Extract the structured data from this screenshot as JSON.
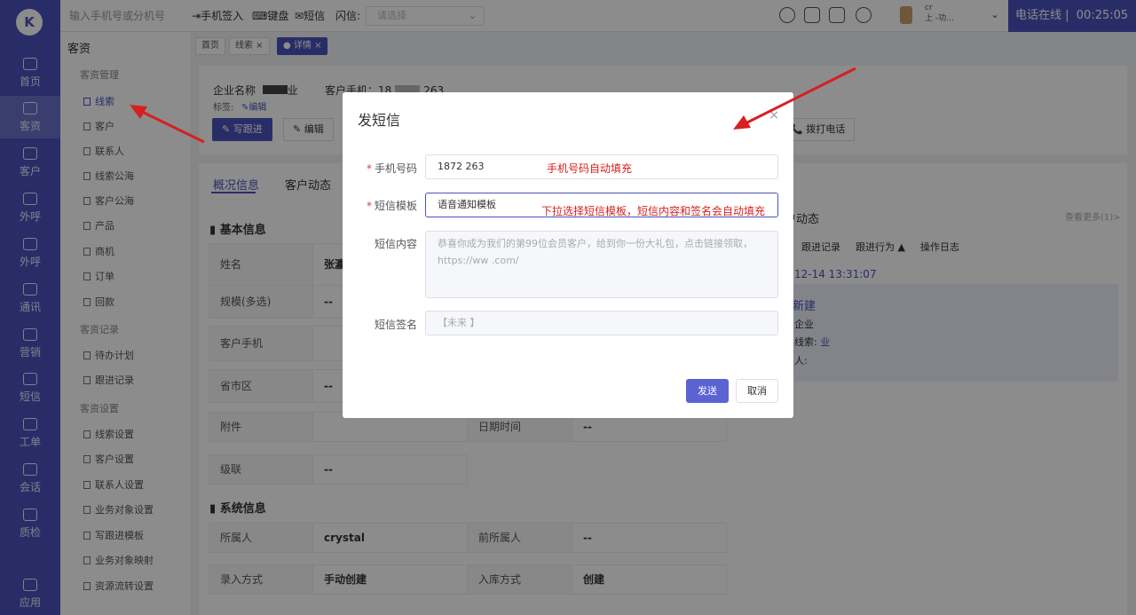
{
  "app": {
    "logo_letter": "K"
  },
  "leftnav": [
    {
      "label": "首页",
      "icon": "home-icon"
    },
    {
      "label": "客资",
      "icon": "users-icon"
    },
    {
      "label": "客户",
      "icon": "user-icon"
    },
    {
      "label": "外呼",
      "icon": "phone-out-icon"
    },
    {
      "label": "外呼",
      "icon": "phone-in-icon"
    },
    {
      "label": "通讯",
      "icon": "contacts-icon"
    },
    {
      "label": "营销",
      "icon": "gear-icon"
    },
    {
      "label": "短信",
      "icon": "mail-icon"
    },
    {
      "label": "工单",
      "icon": "clipboard-icon"
    },
    {
      "label": "会话",
      "icon": "chat-icon"
    },
    {
      "label": "质检",
      "icon": "check-icon"
    },
    {
      "label": "应用",
      "icon": "apps-icon"
    }
  ],
  "topbar": {
    "search_placeholder": "输入手机号或分机号",
    "phone_login": "手机签入",
    "keyboard": "键盘",
    "sms": "短信",
    "flash_label": "闪信:",
    "flash_placeholder": "请选择",
    "user_line1": "cr",
    "user_line2": "上  -功...",
    "status": "电话在线 |",
    "timer": "00:25:05"
  },
  "side": {
    "title": "客资",
    "groups": [
      {
        "label": "客资管理",
        "items": [
          "线索",
          "客户",
          "联系人",
          "线索公海",
          "客户公海",
          "产品",
          "商机",
          "订单",
          "回款"
        ]
      },
      {
        "label": "客资记录",
        "items": [
          "待办计划",
          "跟进记录"
        ]
      },
      {
        "label": "客资设置",
        "items": [
          "线索设置",
          "客户设置",
          "联系人设置",
          "业务对象设置",
          "写跟进模板",
          "业务对象映射",
          "资源流转设置"
        ]
      }
    ]
  },
  "tabs": [
    "首页",
    "线索 ×",
    "● 详情 ×"
  ],
  "header": {
    "company_label": "企业名称",
    "company_value": "业",
    "mobile_label": "客户手机：18",
    "mobile_suffix": "263",
    "tag_label": "标签:",
    "tag_edit": "编辑",
    "btn_follow": "写跟进",
    "btn_edit": "编辑",
    "btn_call": "拨打电话"
  },
  "content_tabs": [
    "概况信息",
    "客户动态"
  ],
  "basic": {
    "title": "基本信息",
    "rows": [
      {
        "label": "姓名",
        "value": "张瀛"
      },
      {
        "label": "规模(多选)",
        "value": "--"
      },
      {
        "label": "客户手机",
        "value": ""
      },
      {
        "label": "省市区",
        "value": "--"
      },
      {
        "label": "附件",
        "value": "",
        "label2": "日期时间",
        "value2": "--"
      },
      {
        "label": "级联",
        "value": "--"
      }
    ]
  },
  "system": {
    "title": "系统信息",
    "rows": [
      {
        "label": "所属人",
        "value": "crystal",
        "label2": "前所属人",
        "value2": "--"
      },
      {
        "label": "录入方式",
        "value": "手动创建",
        "label2": "入库方式",
        "value2": "创建"
      }
    ]
  },
  "dynamic": {
    "title": "户动态",
    "more": "查看更多(1)>",
    "filters": [
      "跟进记录",
      "跟进行为 ▲",
      "操作日志"
    ],
    "time": "12-14 13:31:07",
    "event": "新建",
    "line1": "企业",
    "line2": "线索:",
    "line2_val": "业",
    "line3": "人:"
  },
  "modal": {
    "title": "发短信",
    "close": "×",
    "phone_label": "手机号码",
    "phone_value": "1872      263",
    "template_label": "短信模板",
    "template_value": "语音通知模板",
    "content_label": "短信内容",
    "content_value": "恭喜你成为我们的第99位会员客户，给到你一份大礼包，点击链接领取，https://ww        .com/",
    "sign_label": "短信签名",
    "sign_value": "【未来    】",
    "send": "发送",
    "cancel": "取消"
  },
  "annotations": {
    "phone_note": "手机号码自动填充",
    "template_note": "下拉选择短信模板，短信内容和签名会自动填充"
  },
  "colors": {
    "primary": "#4b53bc",
    "annotation": "#d61f1f",
    "send": "#5b63d3"
  }
}
